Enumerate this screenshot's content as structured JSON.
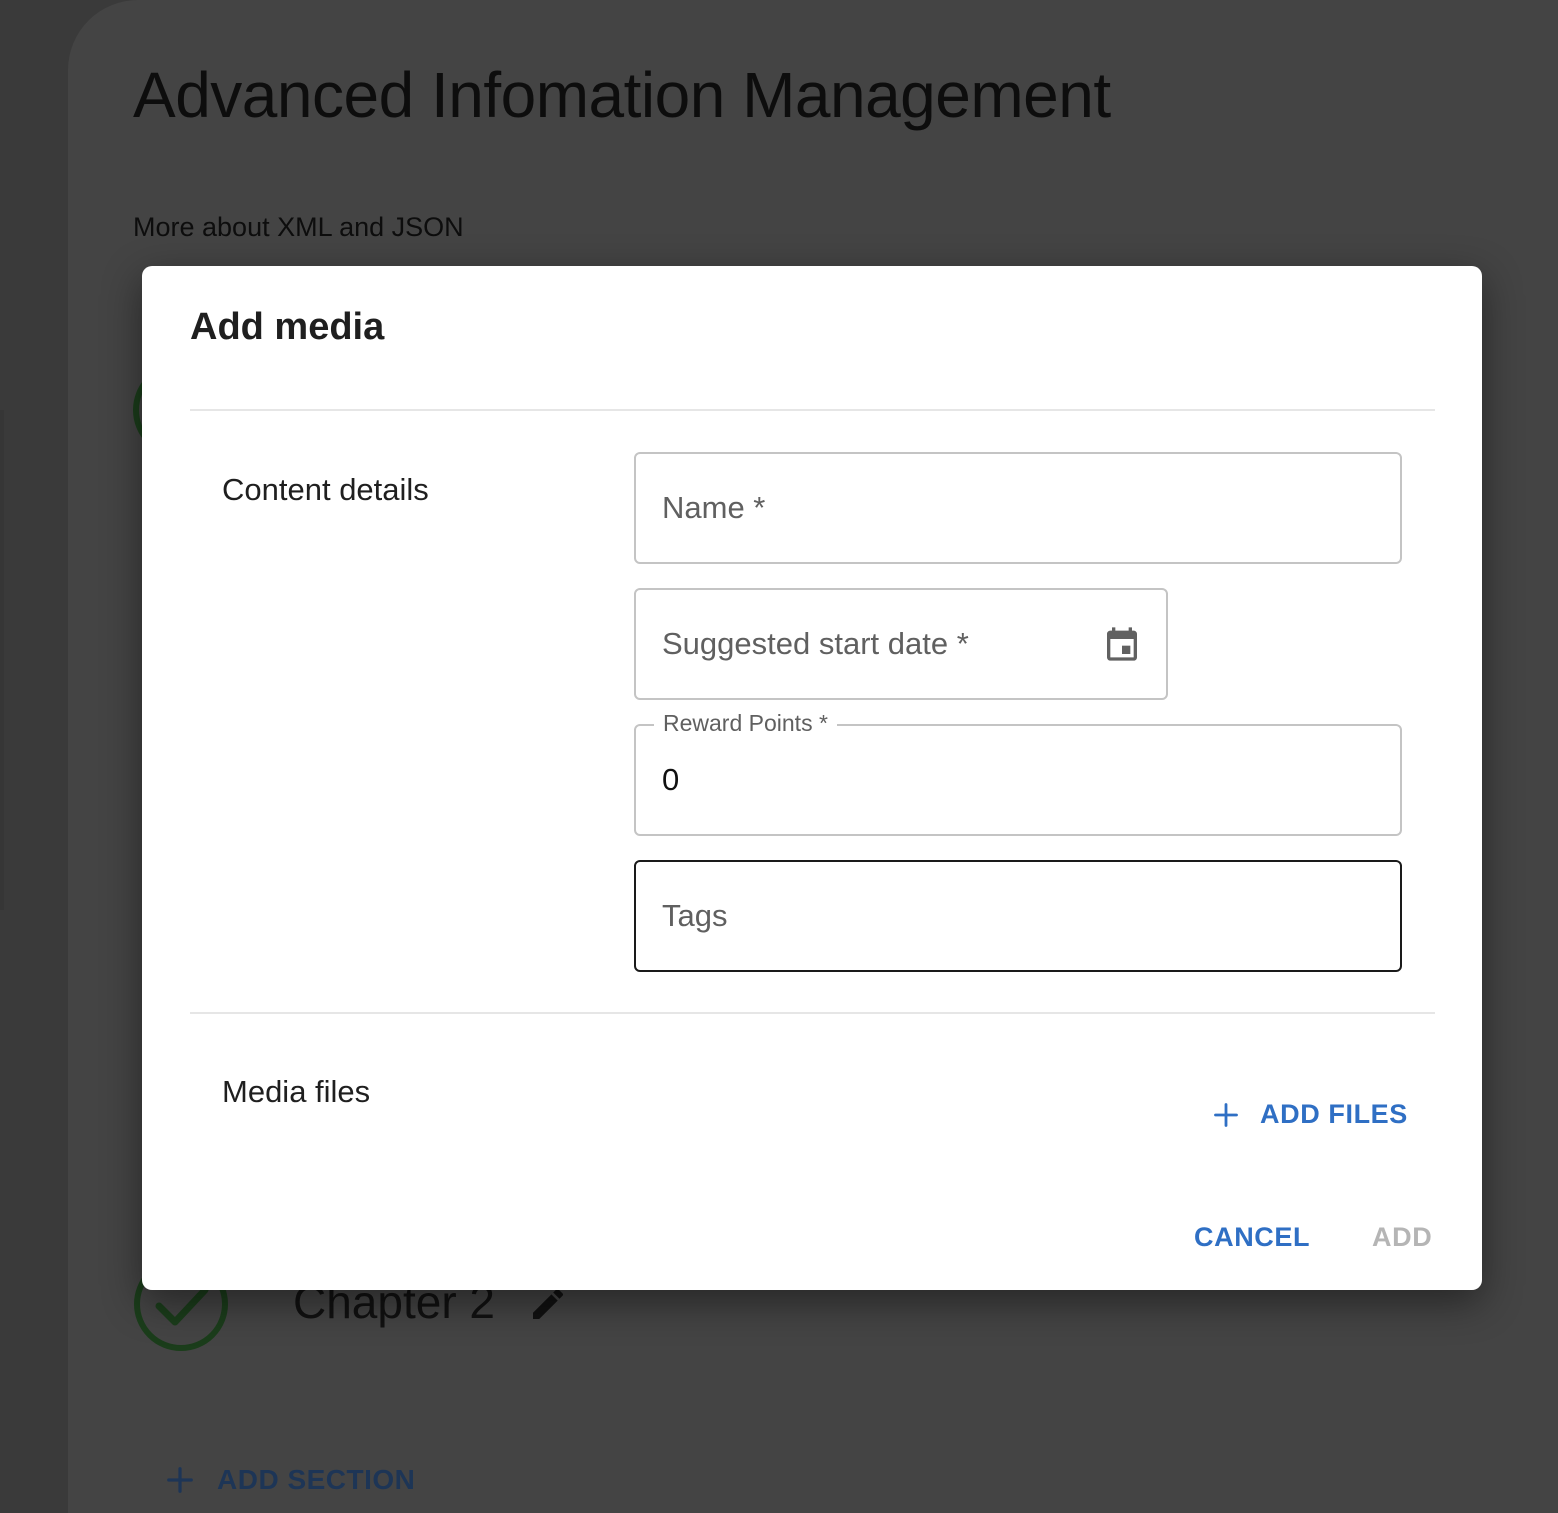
{
  "background": {
    "course_title": "Advanced Infomation Management",
    "course_subtitle": "More about XML and JSON",
    "chapter_title": "Chapter 2",
    "add_section_label": "ADD SECTION",
    "icons": [
      "check-icon",
      "pencil-icon",
      "plus-icon"
    ]
  },
  "dialog": {
    "title": "Add media",
    "content_details_label": "Content details",
    "fields": {
      "name": {
        "placeholder": "Name *"
      },
      "start_date": {
        "placeholder": "Suggested start date *",
        "icon": "calendar-icon"
      },
      "reward_points": {
        "label": "Reward Points *",
        "value": "0"
      },
      "tags": {
        "placeholder": "Tags"
      }
    },
    "media_files_label": "Media files",
    "add_files_label": "ADD FILES",
    "cancel_label": "CANCEL",
    "add_label": "ADD"
  },
  "colors": {
    "accent": "#2f6fc4",
    "disabled": "#b5b5b5",
    "overlay": "#3a3a3a",
    "check_green": "#1b3d1b"
  }
}
